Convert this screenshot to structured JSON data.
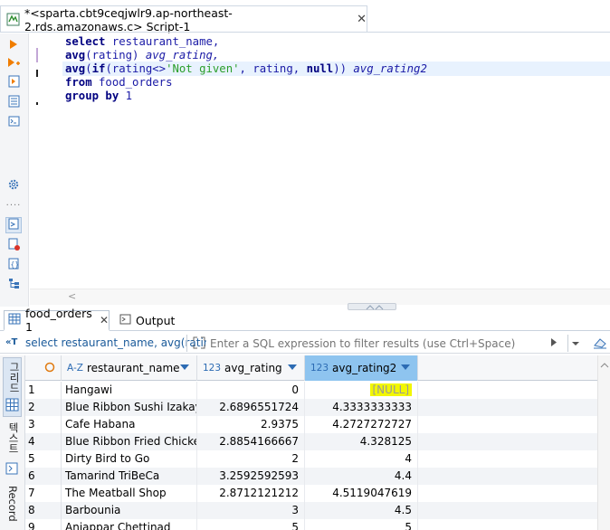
{
  "editor_tab": {
    "title": "*<sparta.cbt9ceqjwlr9.ap-northeast-2.rds.amazonaws.c> Script-1",
    "close": "✕"
  },
  "sql": {
    "lines": [
      [
        {
          "t": "select ",
          "c": "kw-blue"
        },
        {
          "t": "restaurant_name,",
          "c": "ident"
        }
      ],
      [
        {
          "t": "avg",
          "c": "kw-blue"
        },
        {
          "t": "(rating) ",
          "c": "ident"
        },
        {
          "t": "avg_rating,",
          "c": "alias"
        }
      ],
      [
        {
          "t": "avg",
          "c": "kw-blue"
        },
        {
          "t": "(",
          "c": "ident"
        },
        {
          "t": "if",
          "c": "kw-blue"
        },
        {
          "t": "(rating<>",
          "c": "ident"
        },
        {
          "t": "'Not given'",
          "c": "str"
        },
        {
          "t": ", rating, ",
          "c": "ident"
        },
        {
          "t": "null",
          "c": "kw-blue"
        },
        {
          "t": ")) ",
          "c": "ident"
        },
        {
          "t": "avg_rating2",
          "c": "alias"
        }
      ],
      [
        {
          "t": "from ",
          "c": "kw-blue"
        },
        {
          "t": "food_orders",
          "c": "ident"
        }
      ],
      [
        {
          "t": "group by ",
          "c": "kw-blue"
        },
        {
          "t": "1",
          "c": "num"
        }
      ]
    ]
  },
  "result_tabs": {
    "tab1": "food_orders 1",
    "tab2": "Output",
    "close": "✕"
  },
  "filter": {
    "query_preview": "select restaurant_name, avg(ratin",
    "placeholder": "Enter a SQL expression to filter results (use Ctrl+Space)"
  },
  "side_panel": {
    "label_grid": "그리드",
    "label_text": "텍스트",
    "label_record": "Record"
  },
  "grid": {
    "columns": [
      {
        "type": "A-Z",
        "name": "restaurant_name"
      },
      {
        "type": "123",
        "name": "avg_rating"
      },
      {
        "type": "123",
        "name": "avg_rating2"
      }
    ],
    "rows": [
      [
        "1",
        "Hangawi",
        "0",
        "[NULL]"
      ],
      [
        "2",
        "Blue Ribbon Sushi Izakaya",
        "2.6896551724",
        "4.3333333333"
      ],
      [
        "3",
        "Cafe Habana",
        "2.9375",
        "4.2727272727"
      ],
      [
        "4",
        "Blue Ribbon Fried Chicken",
        "2.8854166667",
        "4.328125"
      ],
      [
        "5",
        "Dirty Bird to Go",
        "2",
        "4"
      ],
      [
        "6",
        "Tamarind TriBeCa",
        "3.2592592593",
        "4.4"
      ],
      [
        "7",
        "The Meatball Shop",
        "2.8712121212",
        "4.5119047619"
      ],
      [
        "8",
        "Barbounia",
        "3",
        "4.5"
      ],
      [
        "9",
        "Anjappar Chettinad",
        "5",
        "5"
      ]
    ]
  },
  "colors": {
    "accent": "#2c6bb3",
    "selected_header": "#8ec4ef",
    "null_highlight": "#f2f700"
  }
}
